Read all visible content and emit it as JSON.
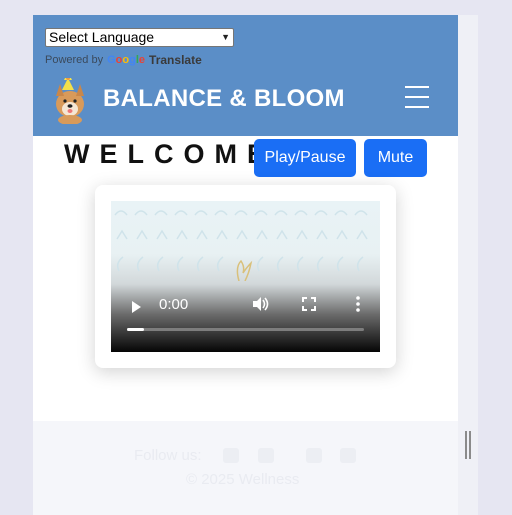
{
  "translate": {
    "select_label": "Select Language",
    "powered_by": "Powered by",
    "google": "Google",
    "translate": "Translate"
  },
  "header": {
    "brand": "BALANCE & BLOOM"
  },
  "welcome": {
    "title": "WELCOME",
    "play_pause_label": "Play/Pause",
    "mute_label": "Mute"
  },
  "video": {
    "current_time": "0:00",
    "progress_fraction": 0.07
  },
  "footer": {
    "follow_label": "Follow us:",
    "copyright": "© 2025 Wellness"
  },
  "colors": {
    "header_bg": "#5b8ec7",
    "button_bg": "#1a6ef5"
  }
}
